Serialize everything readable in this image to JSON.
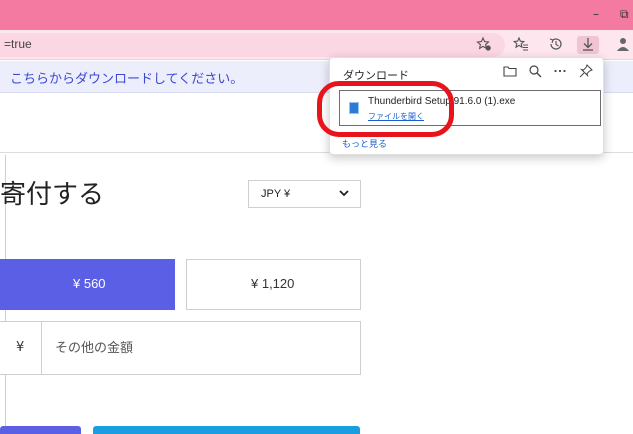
{
  "window": {
    "minimize_glyph": "–",
    "restore_glyph": "⧉"
  },
  "toolbar": {
    "url_fragment": "=true",
    "icons": [
      "favorites-add-icon",
      "favorites-icon",
      "history-icon",
      "downloads-icon",
      "profile-icon"
    ]
  },
  "infobar": {
    "text": "こちらからダウンロードしてください。"
  },
  "downloads": {
    "title": "ダウンロード",
    "item": {
      "filename": "Thunderbird Setup 91.6.0 (1).exe",
      "open_link": "ファイルを開く"
    },
    "see_more": "もっと見る"
  },
  "donation": {
    "heading": "寄付する",
    "currency": "JPY ¥",
    "amounts": [
      "¥ 560",
      "¥ 1,120"
    ],
    "other_prefix": "¥",
    "other_placeholder": "その他の金額"
  },
  "colors": {
    "titlebar": "#f47aa2",
    "accent": "#5b5fe6",
    "secondary_button": "#1b9ee0",
    "highlight": "#e8141b"
  }
}
